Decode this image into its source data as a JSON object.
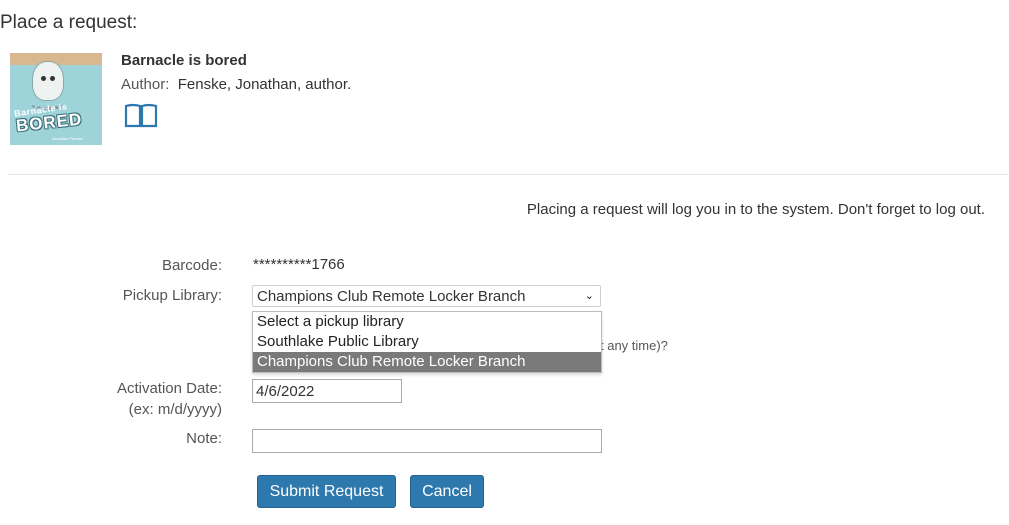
{
  "page": {
    "title": "Place a request:"
  },
  "item": {
    "title": "Barnacle is bored",
    "author_label": "Author:",
    "author_value": "Fenske, Jonathan, author.",
    "format_icon": "book-icon",
    "cover": {
      "small_title": "Barnacle is",
      "big_title": "BORED",
      "author": "Jonathan Fenske"
    }
  },
  "notice": "Placing a request will log you in to the system. Don't forget to log out.",
  "form": {
    "barcode_label": "Barcode:",
    "barcode_value": "**********1766",
    "pickup_label": "Pickup Library:",
    "pickup_selected": "Champions Club Remote Locker Branch",
    "pickup_options": [
      "Select a pickup library",
      "Southlake Public Library",
      "Champions Club Remote Locker Branch"
    ],
    "obscured_text": "t any time)?",
    "activation_label_line1": "Activation Date:",
    "activation_label_line2": "(ex: m/d/yyyy)",
    "activation_value": "4/6/2022",
    "note_label": "Note:",
    "note_value": "",
    "submit_label": "Submit Request",
    "cancel_label": "Cancel"
  },
  "colors": {
    "button_bg": "#2d78ad",
    "selected_option_bg": "#7a7a7a"
  }
}
